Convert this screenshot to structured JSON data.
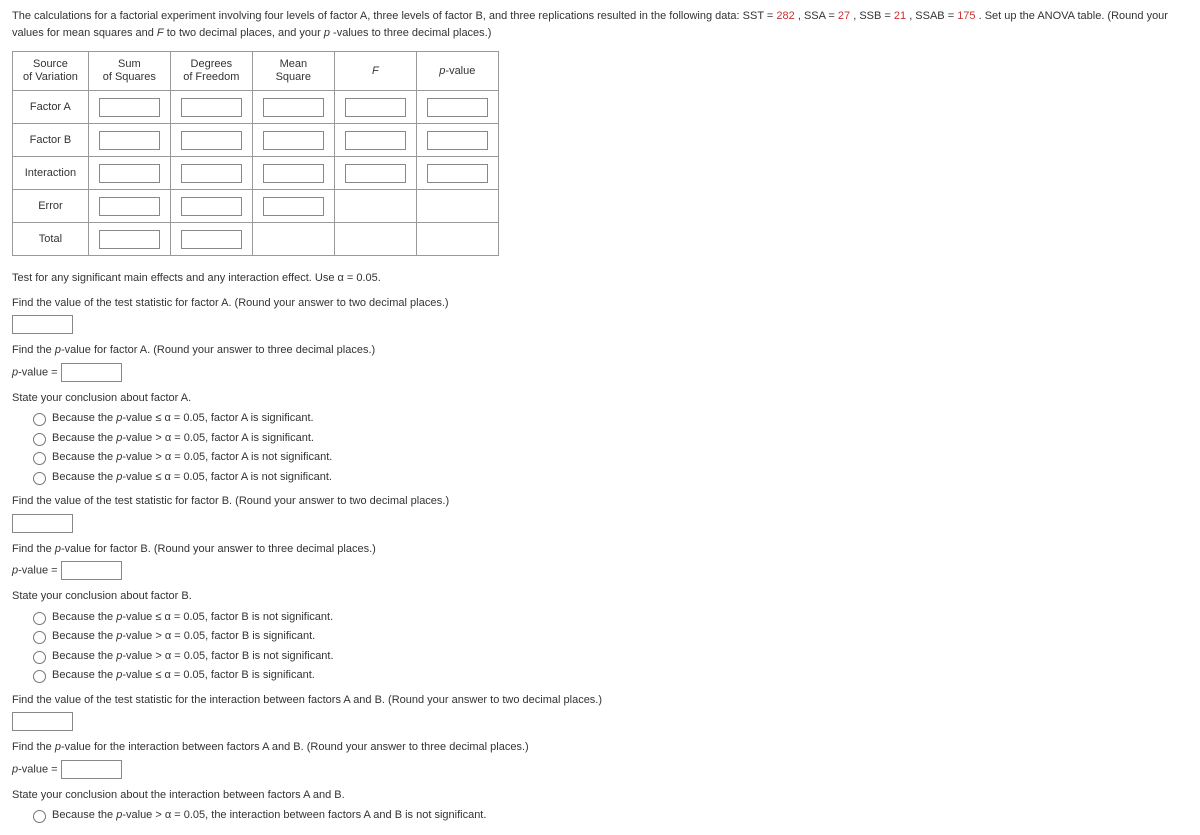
{
  "intro": {
    "prefix": "The calculations for a factorial experiment involving four levels of factor A, three levels of factor B, and three replications resulted in the following data: SST = ",
    "sst": "282",
    "mid1": ", SSA = ",
    "ssa": "27",
    "mid2": ", SSB = ",
    "ssb": "21",
    "mid3": ", SSAB = ",
    "ssab": "175",
    "suffix1": ". Set up the ANOVA table. (Round your values for mean squares and ",
    "fital": "F",
    "suffix2": " to two decimal places, and your ",
    "pital": "p",
    "suffix3": "-values to three decimal places.)"
  },
  "table": {
    "headers": {
      "c1a": "Source",
      "c1b": "of Variation",
      "c2a": "Sum",
      "c2b": "of Squares",
      "c3a": "Degrees",
      "c3b": "of Freedom",
      "c4a": "Mean",
      "c4b": "Square",
      "c5": "F",
      "c6": "p-value"
    },
    "rows": {
      "r1": "Factor A",
      "r2": "Factor B",
      "r3": "Interaction",
      "r4": "Error",
      "r5": "Total"
    }
  },
  "q1": {
    "test_line": "Test for any significant main effects and any interaction effect. Use α = 0.05.",
    "findA": "Find the value of the test statistic for factor A. (Round your answer to two decimal places.)"
  },
  "qA": {
    "findp_pre": "Find the ",
    "findp_mid": "-value for factor A. (Round your answer to three decimal places.)",
    "pval_label_pre": "p",
    "pval_label_post": "-value = ",
    "state": "State your conclusion about factor A.",
    "opt1_pre": "Because the ",
    "opt1_mid": "-value ≤ α = 0.05, factor A is significant.",
    "opt2_pre": "Because the ",
    "opt2_mid": "-value > α = 0.05, factor A is significant.",
    "opt3_pre": "Because the ",
    "opt3_mid": "-value > α = 0.05, factor A is not significant.",
    "opt4_pre": "Because the ",
    "opt4_mid": "-value ≤ α = 0.05, factor A is not significant."
  },
  "qBfind": "Find the value of the test statistic for factor B. (Round your answer to two decimal places.)",
  "qB": {
    "findp_pre": "Find the ",
    "findp_mid": "-value for factor B. (Round your answer to three decimal places.)",
    "pval_label_pre": "p",
    "pval_label_post": "-value = ",
    "state": "State your conclusion about factor B.",
    "opt1_pre": "Because the ",
    "opt1_mid": "-value ≤ α = 0.05, factor B is not significant.",
    "opt2_pre": "Because the ",
    "opt2_mid": "-value > α = 0.05, factor B is significant.",
    "opt3_pre": "Because the ",
    "opt3_mid": "-value > α = 0.05, factor B is not significant.",
    "opt4_pre": "Because the ",
    "opt4_mid": "-value ≤ α = 0.05, factor B is significant."
  },
  "qABfind": "Find the value of the test statistic for the interaction between factors A and B. (Round your answer to two decimal places.)",
  "qAB": {
    "findp_pre": "Find the ",
    "findp_mid": "-value for the interaction between factors A and B. (Round your answer to three decimal places.)",
    "pval_label_pre": "p",
    "pval_label_post": "-value = ",
    "state": "State your conclusion about the interaction between factors A and B.",
    "opt1_pre": "Because the ",
    "opt1_mid": "-value > α = 0.05, the interaction between factors A and B is not significant."
  },
  "p_letter": "p"
}
